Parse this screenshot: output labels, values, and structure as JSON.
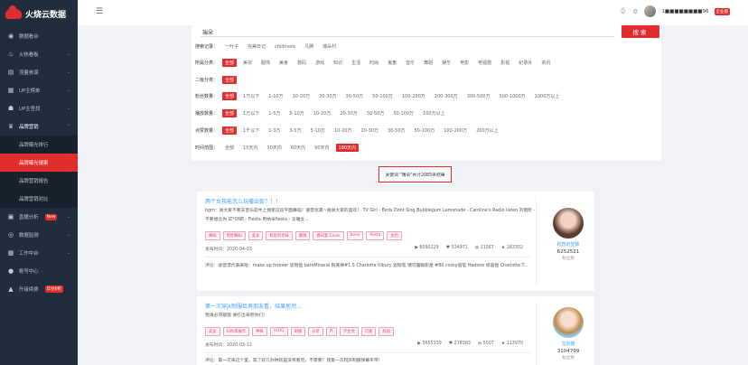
{
  "app": {
    "logo_text": "火烧云数据",
    "brand_color": "#e02e2e"
  },
  "sidebar": {
    "items": [
      {
        "label": "数据看台",
        "icon": "dashboard-icon"
      },
      {
        "label": "火热看板",
        "icon": "flame-icon"
      },
      {
        "label": "流量参谋",
        "icon": "traffic-icon"
      },
      {
        "label": "UP主榜单",
        "icon": "rank-icon"
      },
      {
        "label": "UP主查找",
        "icon": "search-up-icon"
      },
      {
        "label": "品牌营销",
        "icon": "brand-icon"
      }
    ],
    "subitems": [
      "品牌曝光排行",
      "品牌曝光搜索",
      "品牌营销报告",
      "品牌营销对比"
    ],
    "items2": [
      {
        "label": "直播分析",
        "badge": "New"
      },
      {
        "label": "数据监测",
        "badge": ""
      },
      {
        "label": "工作中台",
        "badge": ""
      },
      {
        "label": "账号中心",
        "badge": ""
      },
      {
        "label": "升级续费",
        "badge": "年付6折"
      }
    ]
  },
  "header": {
    "phone": "1■■■■■■■■96",
    "enterprise": "企业版"
  },
  "search": {
    "value": "瑞朵",
    "button": "搜索"
  },
  "filters": {
    "history_label": "搜索记录：",
    "history": [
      "一叶子",
      "完美日记",
      "chillmore",
      "凡腾",
      "瑞朵村"
    ],
    "category_label": "所属分类：",
    "categories": [
      "全部",
      "美妆",
      "服饰",
      "美食",
      "数码",
      "游戏",
      "知识",
      "生活",
      "时尚",
      "鬼畜",
      "音乐",
      "舞蹈",
      "娱乐",
      "电影",
      "电视剧",
      "影视",
      "纪录片",
      "资讯"
    ],
    "sub_label": "二级分类：",
    "sub": [
      "全部"
    ],
    "fans_label": "粉丝数量：",
    "fans": [
      "全部",
      "1万以下",
      "1-10万",
      "10-20万",
      "20-30万",
      "30-50万",
      "50-100万",
      "100-200万",
      "200-300万",
      "300-500万",
      "500-1000万",
      "1000万以上"
    ],
    "play_label": "播放数量：",
    "play": [
      "全部",
      "1万以下",
      "1-5万",
      "5-10万",
      "10-20万",
      "20-30万",
      "30-50万",
      "50-100万",
      "100万以上"
    ],
    "like_label": "点赞数量：",
    "like": [
      "全部",
      "1千以下",
      "1-3万",
      "3-5万",
      "5-10万",
      "10-20万",
      "20-30万",
      "30-50万",
      "50-100万",
      "100-200万",
      "200万以上"
    ],
    "time_label": "时间范围：",
    "time": [
      "全部",
      "15天内",
      "30天内",
      "60天内",
      "90天内",
      "180天内"
    ]
  },
  "result_text": "关键词 \"瑞朵\"共计2085条结果",
  "cards": [
    {
      "title": "两个女孩能怎么玩撒出街？！！",
      "desc": "bgm：请大家不要去音乐软件上搜索这段平面舞蹈！姿势优美~谢谢大家的喜欢！ TV Girl - Birds Dont Sing Bubblegum Lemonade - Caroline's Radio listen 刘雨昕 - 不要想念你 IZ*ONE - Fiesta 用纳米fiesta - 淡雅女...",
      "tags": [
        "舞蹈",
        "明星舞蹈",
        "美女",
        "机智的党妹",
        "翻跳",
        "春日复工look",
        "bone",
        "fiesta",
        "女团"
      ],
      "date_label": "发布时间：",
      "date": "2020-04-03",
      "views": "6090229",
      "likes": "534971",
      "coins": "21567",
      "favs": "163302",
      "comment": "评论：收音漂代表来啦：make up forever 遮瑕盘 bareMineral 粉底棒#1.5 Charlotte tilbury 遮瑕笔 瑞可露眼影盘 #80 cocky眉笔 Hedone 修容盘 Charlotte T...",
      "author": "机智的党妹",
      "fans": "6252521",
      "fans_label": "粉丝数"
    },
    {
      "title": "第一次穿jk制服给男朋友看，结果居然...",
      "desc": "我请必须部骚 请打出来吧你们！",
      "tags": [
        "美女",
        "扫你来展示",
        "种草",
        "VLOG",
        "制服",
        "分享",
        "JK",
        "学生党",
        "可爱",
        "校园"
      ],
      "date_label": "发布时间：",
      "date": "2020-03-12",
      "views": "3655339",
      "likes": "278383",
      "coins": "5507",
      "favs": "113970",
      "comment": "评论：第一次来这个里，等了好几秒钟就是没有看完，不需要？我第一次积JK制服弹幕夹带！",
      "author": "宝剑嫂",
      "fans": "3104799",
      "fans_label": "粉丝数"
    }
  ]
}
